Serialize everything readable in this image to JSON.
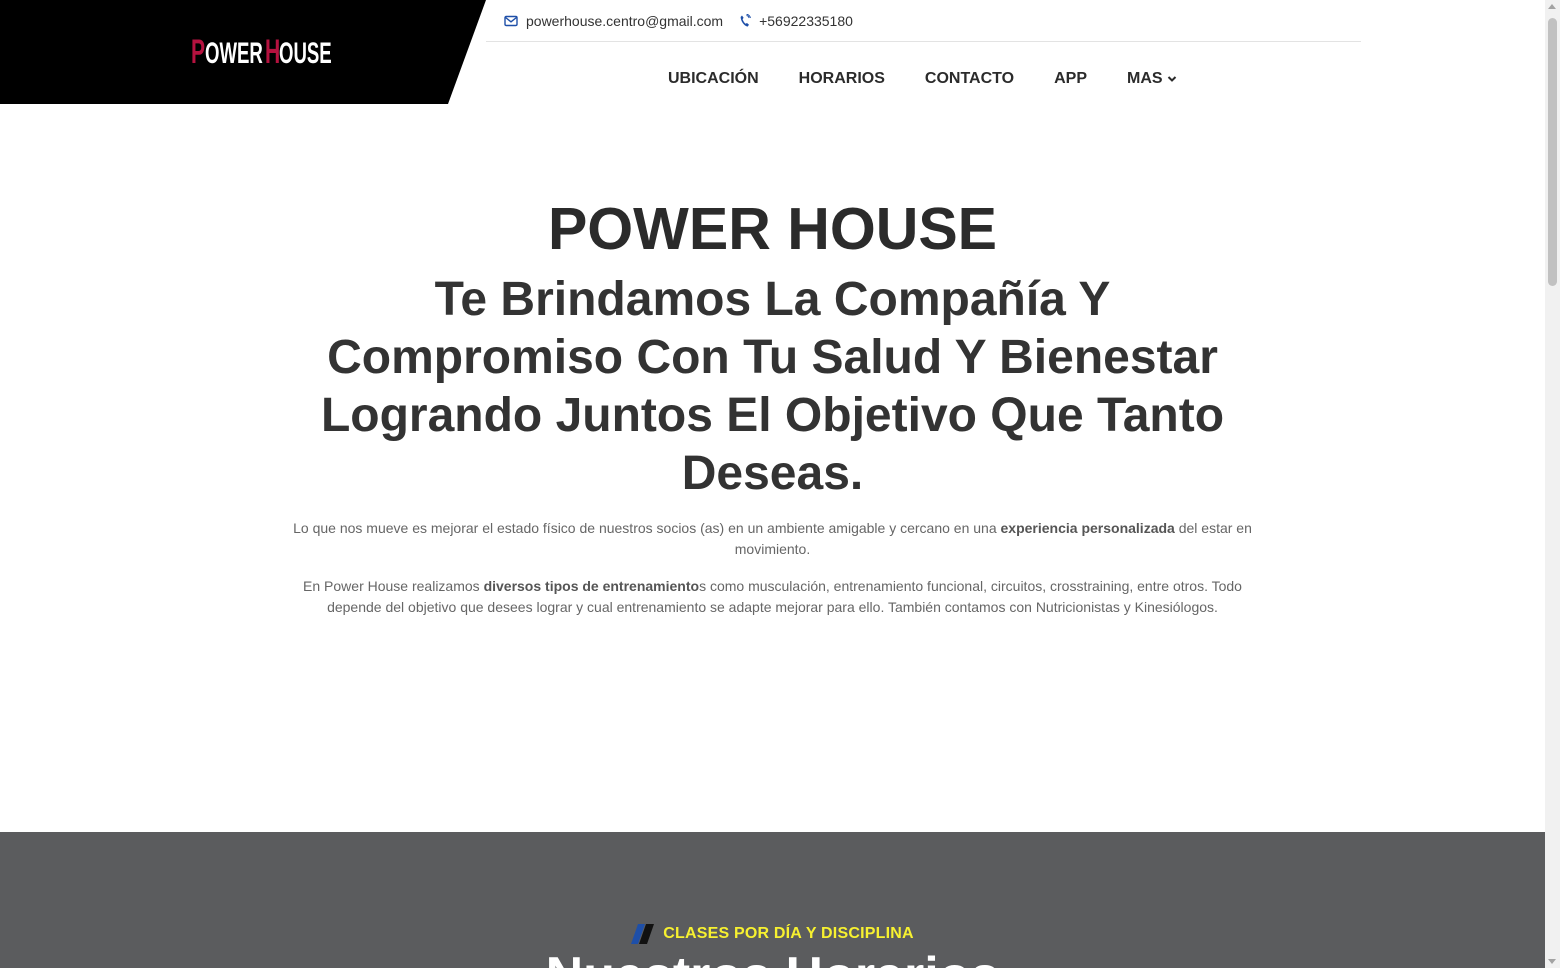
{
  "header": {
    "logo": {
      "first_initial": "P",
      "first_rest": "OWER",
      "second_initial": "H",
      "second_rest": "OUSE"
    },
    "contact": {
      "email": "powerhouse.centro@gmail.com",
      "phone": "+56922335180"
    },
    "nav": {
      "items": [
        "UBICACIÓN",
        "HORARIOS",
        "CONTACTO",
        "APP"
      ],
      "more_label": "MAS"
    }
  },
  "hero": {
    "title": "POWER HOUSE",
    "subtitle": "Te Brindamos La Compañía Y Compromiso Con Tu Salud Y Bienestar Logrando Juntos El Objetivo Que Tanto Deseas.",
    "p1": {
      "before": "Lo que nos mueve es mejorar el estado físico de nuestros socios (as) en un ambiente amigable y cercano en una ",
      "bold": "experiencia personalizada",
      "after": " del estar en movimiento."
    },
    "p2": {
      "before": "En Power House realizamos ",
      "bold": "diversos tipos de entrenamiento",
      "after": "s como musculación, entrenamiento funcional, circuitos, crosstraining, entre otros. Todo depende del objetivo que desees lograr y cual entrenamiento se adapte mejorar para ello. También contamos con Nutricionistas y Kinesiólogos."
    }
  },
  "schedule_section": {
    "tagline": "CLASES POR DÍA Y DISCIPLINA",
    "title": "Nuestros Horarios"
  },
  "colors": {
    "logo_accent": "#b5123f",
    "dark_section_bg": "#5b5c5e",
    "tagline_yellow": "#f7f130",
    "icon_blue": "#1e4fa8"
  },
  "icons": {
    "email": "envelope-icon",
    "phone": "phone-icon",
    "more": "chevron-down-icon",
    "tagline": "slash-mark-icon"
  }
}
